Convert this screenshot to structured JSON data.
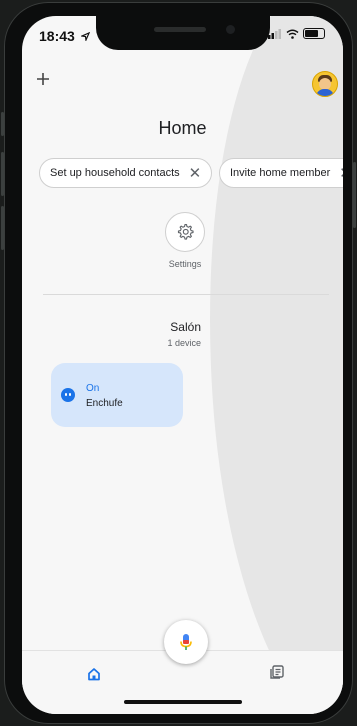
{
  "status_bar": {
    "time": "18:43",
    "location_icon": "location-arrow-icon",
    "signal_icon": "signal-icon",
    "wifi_icon": "wifi-icon",
    "battery_icon": "battery-icon"
  },
  "header": {
    "add_icon": "plus-icon",
    "avatar_icon": "avatar-icon",
    "title": "Home"
  },
  "chips": [
    {
      "label": "Set up household contacts",
      "close_icon": "close-icon"
    },
    {
      "label": "Invite home member",
      "close_icon": "close-icon"
    }
  ],
  "settings": {
    "label": "Settings",
    "icon": "gear-icon"
  },
  "room": {
    "name": "Salón",
    "device_count": "1 device"
  },
  "device": {
    "state": "On",
    "name": "Enchufe",
    "icon": "plug-icon",
    "accent": "#1a73e8",
    "card_color": "#d6e6fb"
  },
  "bottom_nav": {
    "home_icon": "home-icon",
    "feed_icon": "feed-icon",
    "mic_icon": "mic-icon"
  }
}
